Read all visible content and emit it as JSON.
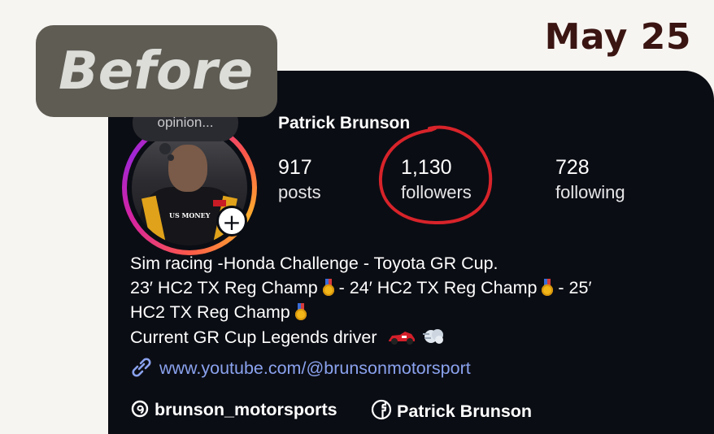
{
  "header": {
    "date": "May 25"
  },
  "badge": {
    "label": "Before"
  },
  "note": {
    "text": "opinion..."
  },
  "profile": {
    "name": "Patrick Brunson",
    "stats": [
      {
        "value": "917",
        "label": "posts"
      },
      {
        "value": "1,130",
        "label": "followers"
      },
      {
        "value": "728",
        "label": "following"
      }
    ],
    "bio": {
      "line1": "Sim racing -Honda Challenge - Toyota GR Cup.",
      "line2a": "23′ HC2 TX Reg Champ ",
      "line2b": " - 24′ HC2 TX Reg Champ ",
      "line2c": " - 25′",
      "line3": "HC2 TX Reg Champ ",
      "line4": "Current GR Cup Legends driver"
    },
    "link": "www.youtube.com/@brunsonmotorsport",
    "threads_handle": "brunson_motorsports",
    "facebook_name": "Patrick Brunson",
    "photo_sponsor_text": "US MONEY"
  },
  "colors": {
    "card_bg": "#0b0d14",
    "link": "#8aa2ee",
    "annotation": "#d8232a",
    "date_text": "#3a1512",
    "badge_bg": "#5e5c53"
  },
  "icons": {
    "medal": "1st-place-medal-icon",
    "race_car": "race-car-icon",
    "dash": "dash-cloud-icon",
    "link": "link-icon",
    "threads": "threads-icon",
    "facebook": "facebook-icon",
    "plus": "plus-icon"
  }
}
